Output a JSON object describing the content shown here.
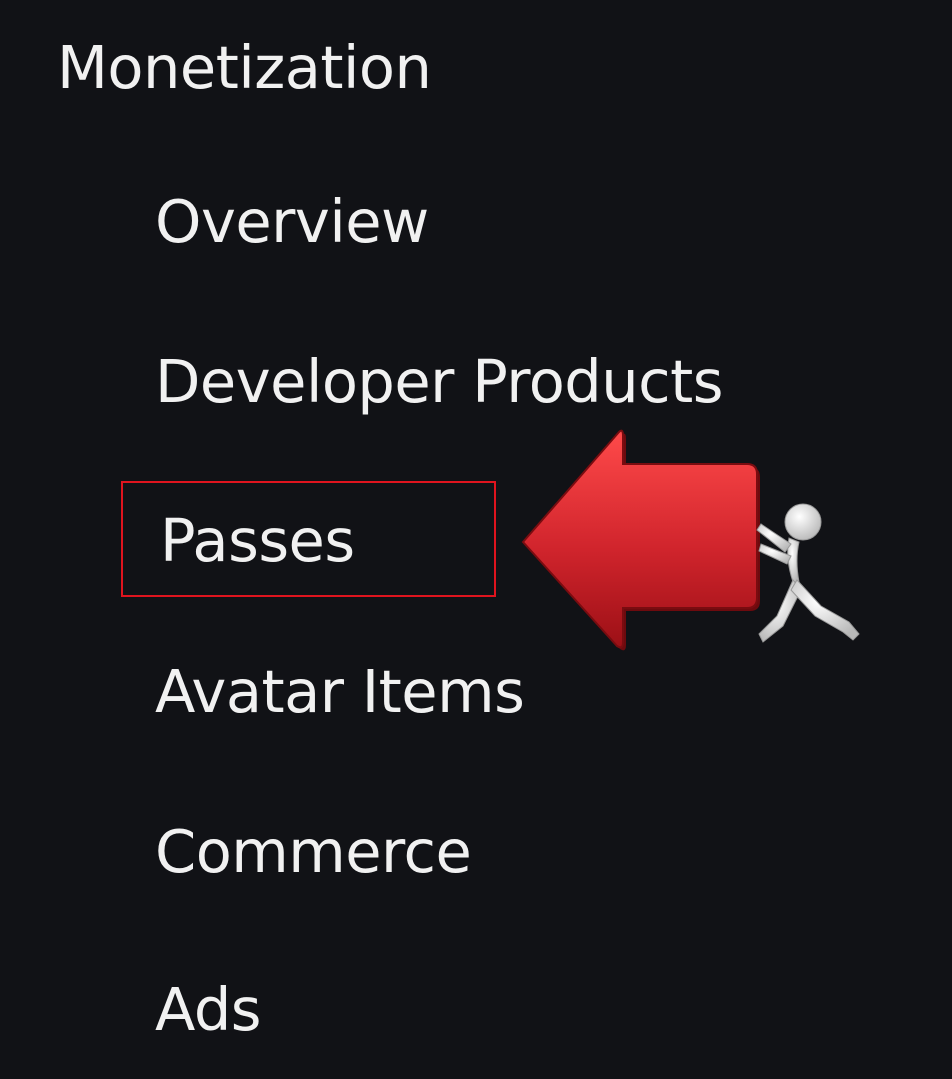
{
  "sidebar": {
    "section_title": "Monetization",
    "items": [
      {
        "label": "Overview"
      },
      {
        "label": "Developer Products"
      },
      {
        "label": "Passes"
      },
      {
        "label": "Avatar Items"
      },
      {
        "label": "Commerce"
      },
      {
        "label": "Ads"
      }
    ],
    "selected_item": "Passes"
  },
  "annotation": {
    "highlight_color": "#e0141e",
    "arrow_color": "#d0242c",
    "figure_icon": "person-pushing-icon"
  }
}
